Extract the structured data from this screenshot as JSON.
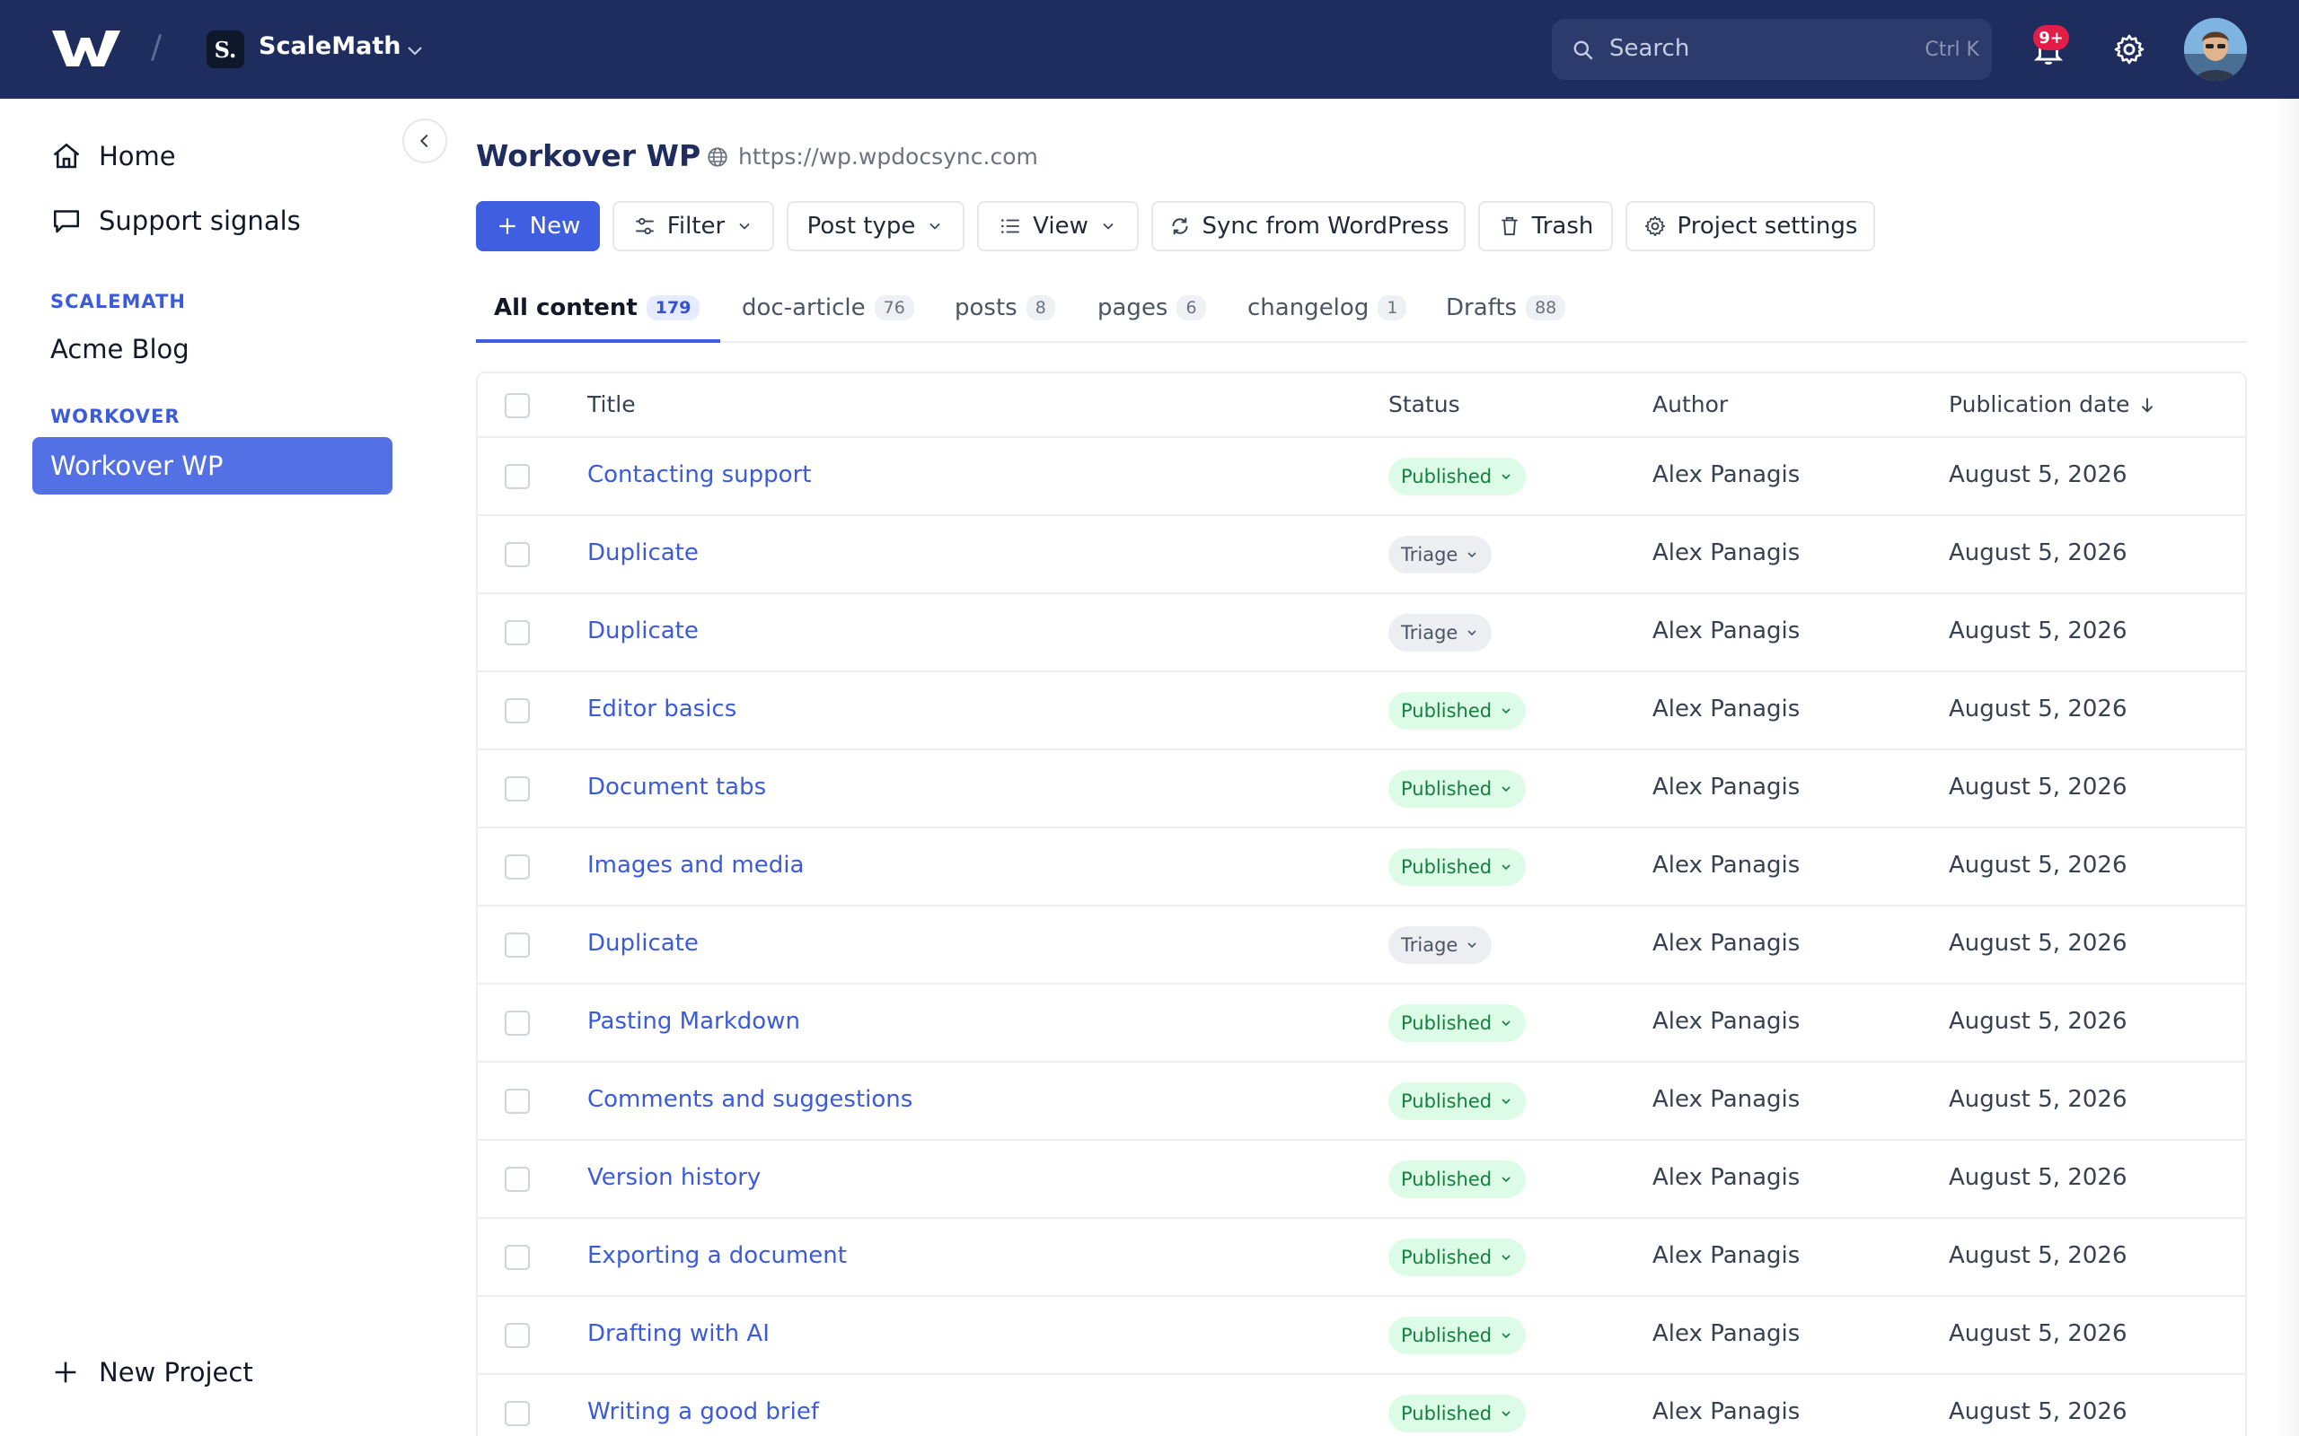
{
  "header": {
    "workspace_initial": "S.",
    "workspace_name": "ScaleMath",
    "crumb_separator": "/",
    "search_placeholder": "Search",
    "search_shortcut": "Ctrl K",
    "notification_badge": "9+"
  },
  "sidebar": {
    "nav": [
      {
        "label": "Home"
      },
      {
        "label": "Support signals"
      }
    ],
    "sections": [
      {
        "label": "SCALEMATH",
        "projects": [
          "Acme Blog"
        ]
      },
      {
        "label": "WORKOVER",
        "projects": [
          "Workover WP"
        ]
      }
    ],
    "new_project_label": "New Project"
  },
  "main": {
    "title": "Workover WP",
    "url": "https://wp.wpdocsync.com",
    "toolbar": {
      "new": "New",
      "filter": "Filter",
      "post_type": "Post type",
      "view": "View",
      "sync": "Sync from WordPress",
      "trash": "Trash",
      "settings": "Project settings"
    },
    "tabs": [
      {
        "label": "All content",
        "count": "179"
      },
      {
        "label": "doc-article",
        "count": "76"
      },
      {
        "label": "posts",
        "count": "8"
      },
      {
        "label": "pages",
        "count": "6"
      },
      {
        "label": "changelog",
        "count": "1"
      },
      {
        "label": "Drafts",
        "count": "88"
      }
    ],
    "table": {
      "headers": {
        "title": "Title",
        "status": "Status",
        "author": "Author",
        "date": "Publication date"
      },
      "rows": [
        {
          "title": "Contacting support",
          "status": "Published",
          "author": "Alex Panagis",
          "date": "August 5, 2026"
        },
        {
          "title": "Duplicate",
          "status": "Triage",
          "author": "Alex Panagis",
          "date": "August 5, 2026"
        },
        {
          "title": "Duplicate",
          "status": "Triage",
          "author": "Alex Panagis",
          "date": "August 5, 2026"
        },
        {
          "title": "Editor basics",
          "status": "Published",
          "author": "Alex Panagis",
          "date": "August 5, 2026"
        },
        {
          "title": "Document tabs",
          "status": "Published",
          "author": "Alex Panagis",
          "date": "August 5, 2026"
        },
        {
          "title": "Images and media",
          "status": "Published",
          "author": "Alex Panagis",
          "date": "August 5, 2026"
        },
        {
          "title": "Duplicate",
          "status": "Triage",
          "author": "Alex Panagis",
          "date": "August 5, 2026"
        },
        {
          "title": "Pasting Markdown",
          "status": "Published",
          "author": "Alex Panagis",
          "date": "August 5, 2026"
        },
        {
          "title": "Comments and suggestions",
          "status": "Published",
          "author": "Alex Panagis",
          "date": "August 5, 2026"
        },
        {
          "title": "Version history",
          "status": "Published",
          "author": "Alex Panagis",
          "date": "August 5, 2026"
        },
        {
          "title": "Exporting a document",
          "status": "Published",
          "author": "Alex Panagis",
          "date": "August 5, 2026"
        },
        {
          "title": "Drafting with AI",
          "status": "Published",
          "author": "Alex Panagis",
          "date": "August 5, 2026"
        },
        {
          "title": "Writing a good brief",
          "status": "Published",
          "author": "Alex Panagis",
          "date": "August 5, 2026"
        }
      ]
    }
  },
  "colors": {
    "header_bg": "#1e2d5e",
    "accent": "#3f5fe0",
    "active_project_bg": "#5470e5",
    "link": "#3b5bdb",
    "published_bg": "#dcfce7",
    "published_fg": "#15803d",
    "triage_bg": "#eceef1"
  }
}
